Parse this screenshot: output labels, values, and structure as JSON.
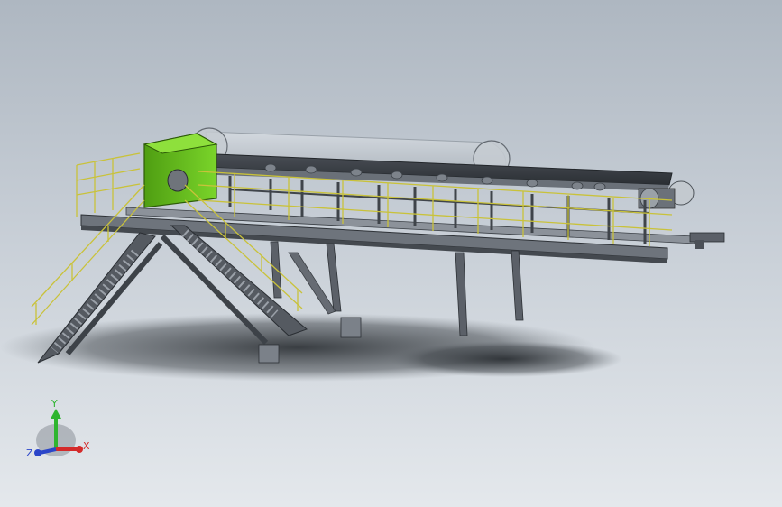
{
  "viewport": {
    "background_top": "#aeb7c1",
    "background_bottom": "#e4e8ec"
  },
  "model": {
    "steel_color": "#5b6068",
    "steel_light": "#8c929a",
    "railing_color": "#c9c23a",
    "hopper_color": "#5fbf1a",
    "cover_color": "#d4d9de"
  },
  "triad": {
    "x_label": "X",
    "y_label": "Y",
    "z_label": "Z",
    "x_color": "#d42a2a",
    "y_color": "#2fb52f",
    "z_color": "#2a45c9"
  }
}
